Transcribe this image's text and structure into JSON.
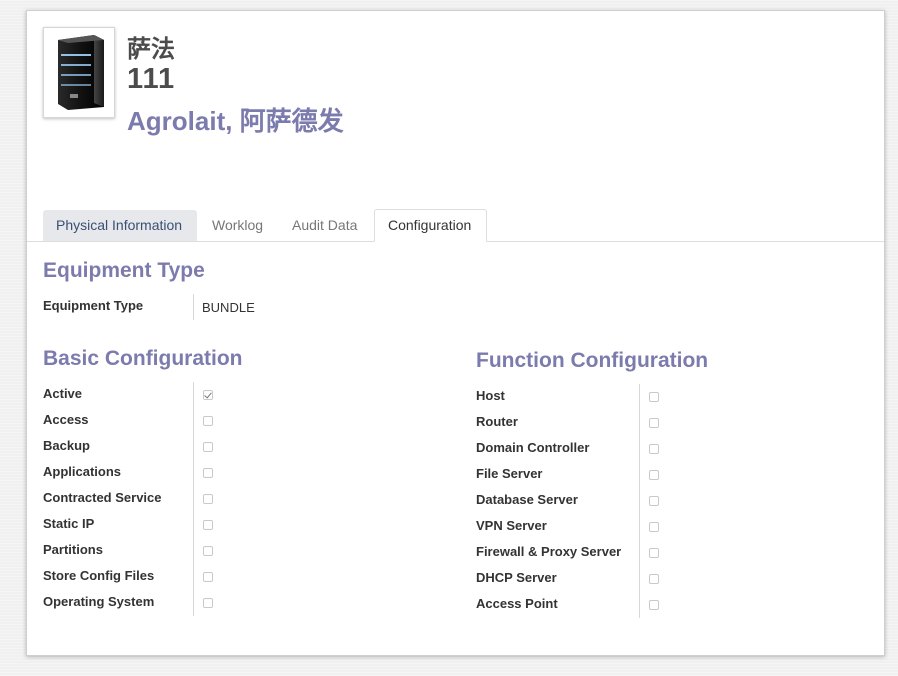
{
  "header": {
    "name_cn": "萨法",
    "number": "111",
    "company": "Agrolait, 阿萨德发",
    "image_icon": "server-tower-icon"
  },
  "tabs": [
    {
      "label": "Physical Information",
      "active": false
    },
    {
      "label": "Worklog",
      "active": false
    },
    {
      "label": "Audit Data",
      "active": false
    },
    {
      "label": "Configuration",
      "active": true
    }
  ],
  "equipment_type": {
    "section_title": "Equipment Type",
    "label": "Equipment Type",
    "value": "BUNDLE"
  },
  "basic_config": {
    "section_title": "Basic Configuration",
    "items": [
      {
        "label": "Active",
        "checked": true
      },
      {
        "label": "Access",
        "checked": false
      },
      {
        "label": "Backup",
        "checked": false
      },
      {
        "label": "Applications",
        "checked": false
      },
      {
        "label": "Contracted Service",
        "checked": false
      },
      {
        "label": "Static IP",
        "checked": false
      },
      {
        "label": "Partitions",
        "checked": false
      },
      {
        "label": "Store Config Files",
        "checked": false
      },
      {
        "label": "Operating System",
        "checked": false
      }
    ]
  },
  "function_config": {
    "section_title": "Function Configuration",
    "items": [
      {
        "label": "Host",
        "checked": false
      },
      {
        "label": "Router",
        "checked": false
      },
      {
        "label": "Domain Controller",
        "checked": false
      },
      {
        "label": "File Server",
        "checked": false
      },
      {
        "label": "Database Server",
        "checked": false
      },
      {
        "label": "VPN Server",
        "checked": false
      },
      {
        "label": "Firewall & Proxy Server",
        "checked": false
      },
      {
        "label": "DHCP Server",
        "checked": false
      },
      {
        "label": "Access Point",
        "checked": false
      }
    ]
  },
  "colors": {
    "accent": "#7c7bad",
    "active_tab_bg": "#e6e8ec",
    "active_tab_text": "#3a4f73"
  }
}
